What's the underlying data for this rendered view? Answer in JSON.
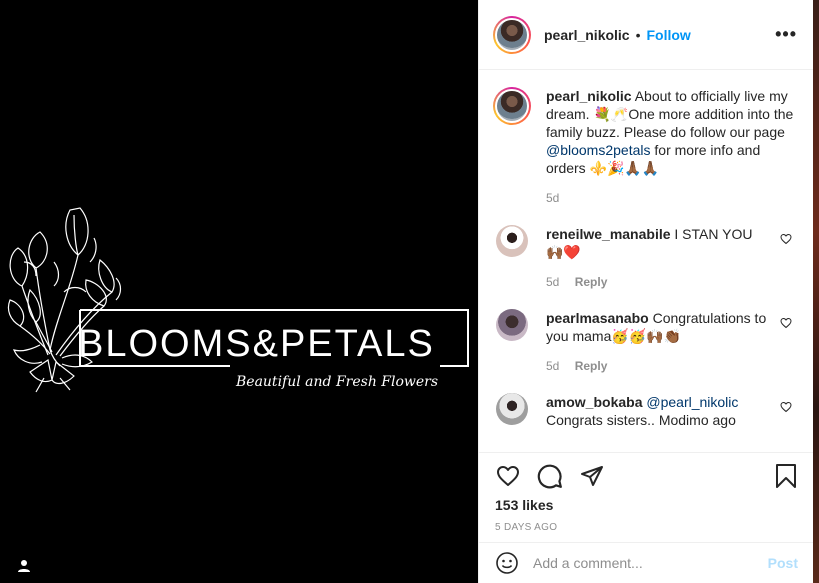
{
  "media": {
    "brand_title": "BLOOMS&PETALS",
    "brand_tagline": "Beautiful and Fresh Flowers",
    "tag_icon": "user-tag-icon"
  },
  "header": {
    "username": "pearl_nikolic",
    "separator": "•",
    "follow_label": "Follow",
    "more_icon": "more-options-icon",
    "more_label": "•••"
  },
  "caption": {
    "username": "pearl_nikolic",
    "text_part1": "About to officially live my dream. 💐🥂One more addition into the family buzz. Please do follow our page ",
    "mention": "@blooms2petals",
    "text_part2": " for more info and orders ⚜️🎉🙏🏾🙏🏾",
    "time": "5d"
  },
  "comments": [
    {
      "username": "reneilwe_manabile",
      "text": "I STAN YOU 🙌🏾❤️",
      "time": "5d",
      "reply_label": "Reply"
    },
    {
      "username": "pearlmasanabo",
      "text": "Congratulations to you mama🥳🥳🙌🏾👏🏾",
      "time": "5d",
      "reply_label": "Reply"
    },
    {
      "username": "amow_bokaba",
      "mention": "@pearl_nikolic",
      "text": "Congrats sisters.. Modimo ago"
    }
  ],
  "actions": {
    "like_icon": "heart-icon",
    "comment_icon": "comment-icon",
    "share_icon": "share-icon",
    "save_icon": "bookmark-icon",
    "likes": "153 likes",
    "posted_ago": "5 DAYS AGO"
  },
  "add_comment": {
    "emoji_icon": "emoji-icon",
    "placeholder": "Add a comment...",
    "post_label": "Post"
  },
  "colors": {
    "accent": "#0095f6",
    "mention": "#00376b",
    "muted": "#8e8e8e",
    "post_disabled": "#b2dffc",
    "heart_red": "#ed4956"
  }
}
